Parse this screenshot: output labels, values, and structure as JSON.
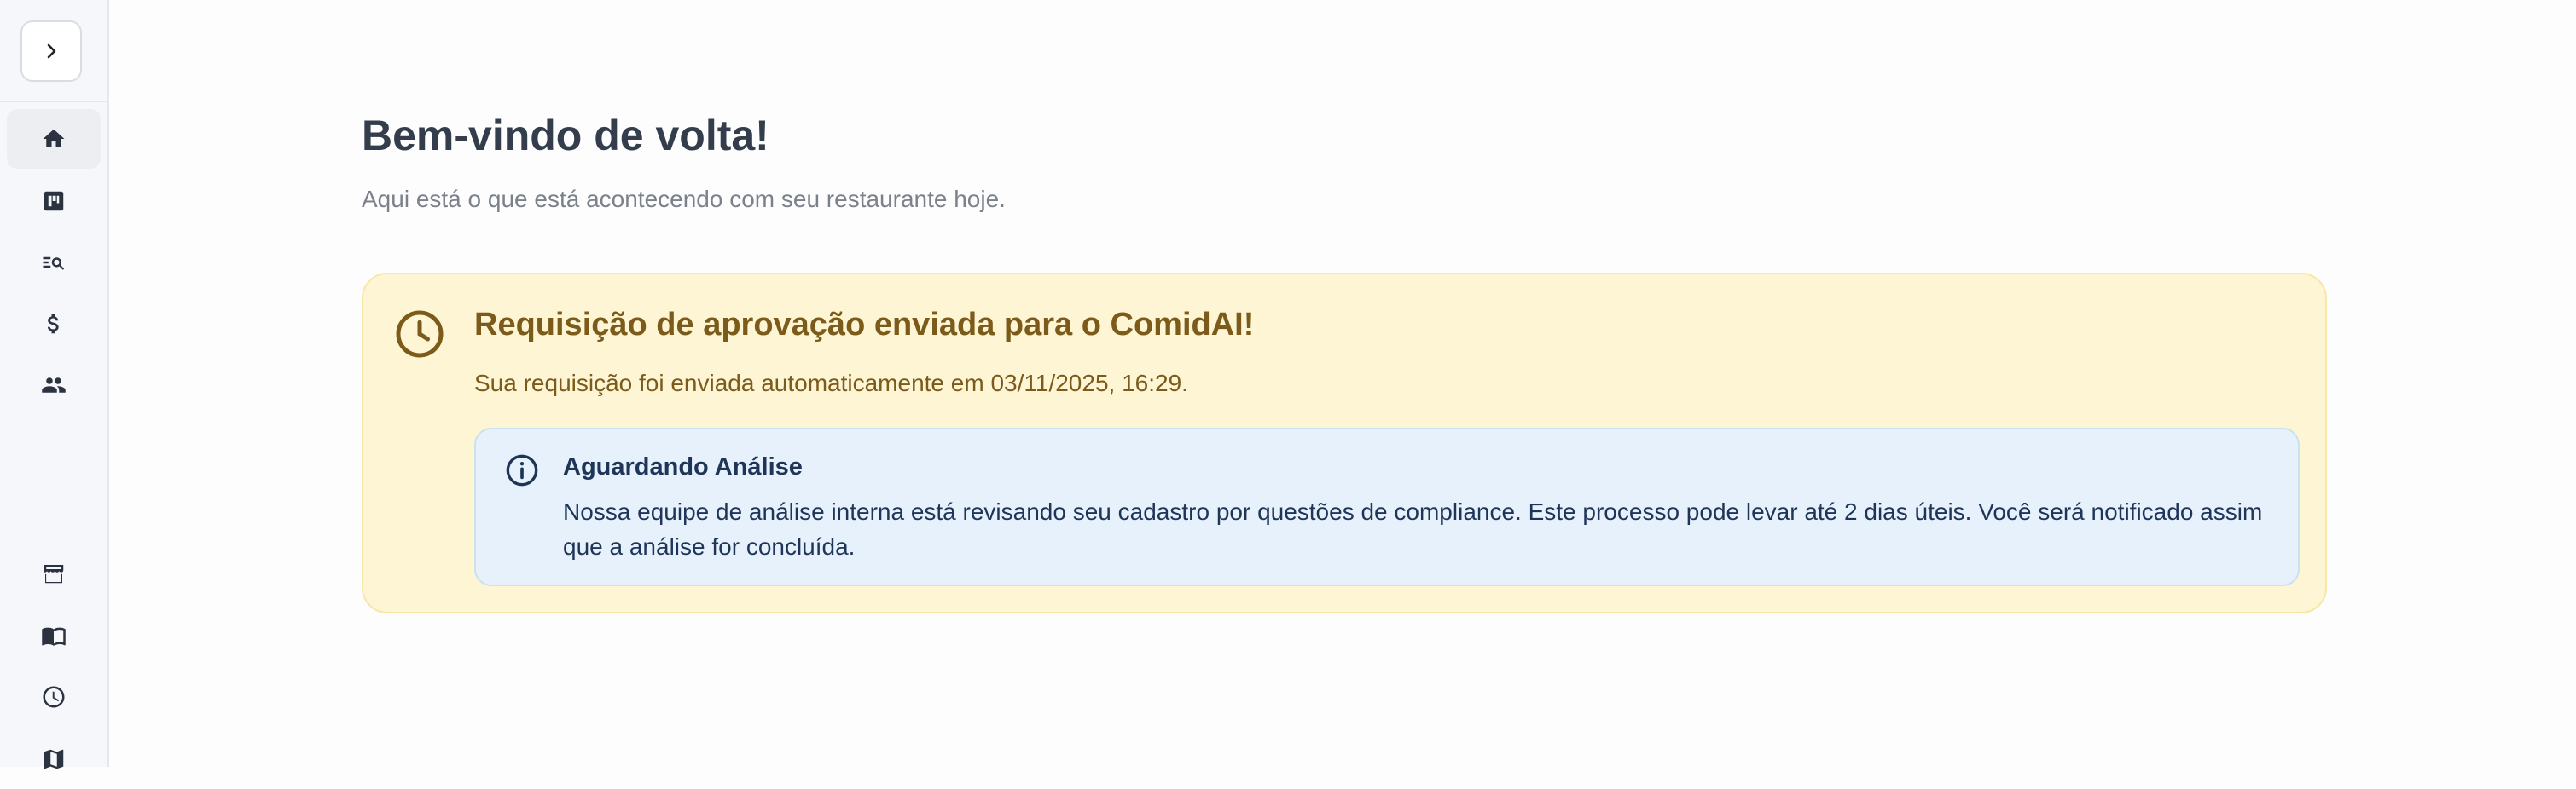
{
  "sidebar": {
    "toggle": {
      "icon": "chevron-right-icon"
    },
    "top_items": [
      {
        "name": "home",
        "icon": "home-icon",
        "active": true
      },
      {
        "name": "dashboard",
        "icon": "board-icon",
        "active": false
      },
      {
        "name": "search-list",
        "icon": "list-search-icon",
        "active": false
      },
      {
        "name": "finance",
        "icon": "dollar-icon",
        "active": false
      },
      {
        "name": "people",
        "icon": "people-icon",
        "active": false
      }
    ],
    "bottom_items": [
      {
        "name": "store",
        "icon": "store-icon"
      },
      {
        "name": "menu",
        "icon": "book-icon"
      },
      {
        "name": "history",
        "icon": "clock-icon"
      },
      {
        "name": "map",
        "icon": "map-icon"
      }
    ]
  },
  "main": {
    "title": "Bem-vindo de volta!",
    "subtitle": "Aqui está o que está acontecendo com seu restaurante hoje."
  },
  "approval": {
    "title": "Requisição de aprovação enviada para o ComidAI!",
    "message": "Sua requisição foi enviada automaticamente em 03/11/2025, 16:29.",
    "icon": "clock-icon",
    "info": {
      "icon": "info-icon",
      "title": "Aguardando Análise",
      "text": "Nossa equipe de análise interna está revisando seu cadastro por questões de compliance. Este processo pode levar até 2 dias úteis. Você será notificado assim que a análise for concluída."
    }
  },
  "colors": {
    "card_bg": "#fdf5d3",
    "card_text": "#7b5a1a",
    "info_bg": "#e7f1fc",
    "info_text": "#1e3558",
    "title": "#333d4c"
  }
}
